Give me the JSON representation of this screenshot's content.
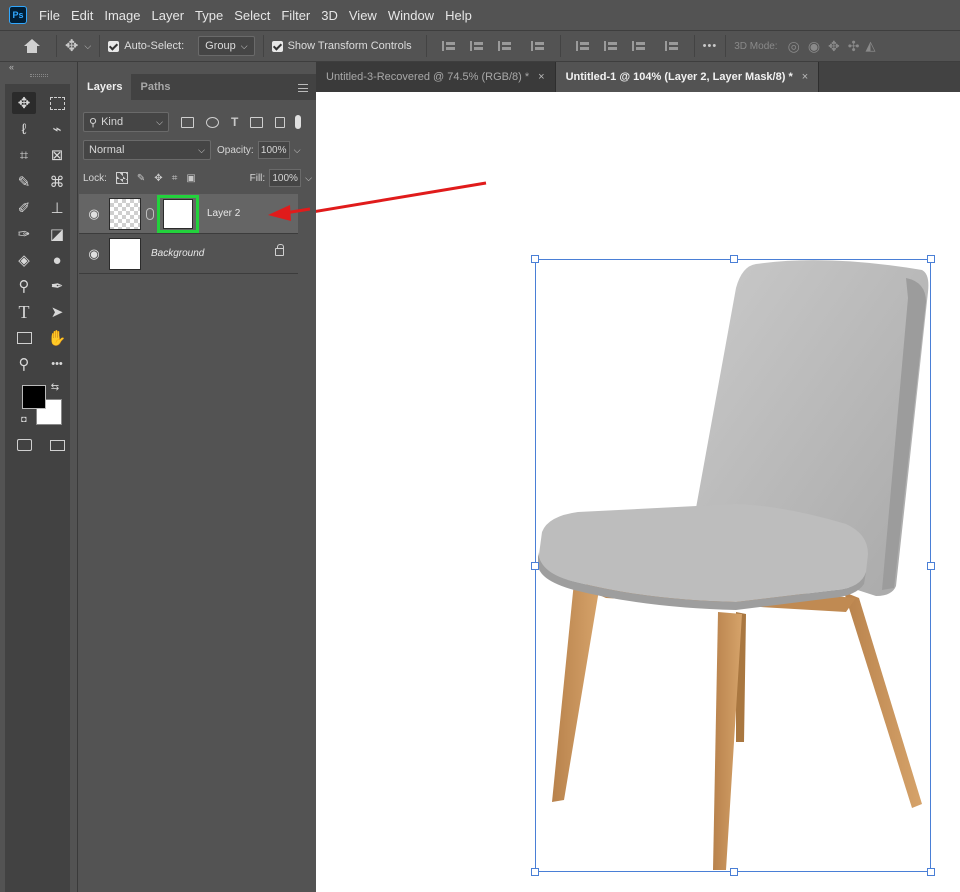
{
  "app": {
    "logo": "Ps",
    "menu": [
      "File",
      "Edit",
      "Image",
      "Layer",
      "Type",
      "Select",
      "Filter",
      "3D",
      "View",
      "Window",
      "Help"
    ]
  },
  "options": {
    "auto_select_label": "Auto-Select:",
    "auto_select_checked": true,
    "group_value": "Group",
    "show_transform_label": "Show Transform Controls",
    "show_transform_checked": true,
    "more": "•••",
    "mode_3d_label": "3D Mode:"
  },
  "layers_panel": {
    "tabs": [
      "Layers",
      "Paths"
    ],
    "kind_label": "Kind",
    "blend_mode": "Normal",
    "opacity_label": "Opacity:",
    "opacity_value": "100%",
    "lock_label": "Lock:",
    "fill_label": "Fill:",
    "fill_value": "100%",
    "layers": [
      {
        "name": "Layer 2",
        "selected": true,
        "has_mask": true
      },
      {
        "name": "Background",
        "selected": false,
        "locked": true
      }
    ]
  },
  "documents": {
    "tabs": [
      {
        "title": "Untitled-3-Recovered @ 74.5% (RGB/8) *",
        "active": false
      },
      {
        "title": "Untitled-1 @ 104% (Layer 2, Layer Mask/8) *",
        "active": true
      }
    ],
    "close_glyph": "×"
  },
  "colors": {
    "mask_highlight": "#22d23c",
    "annotation_arrow": "#e01b1b",
    "transform_box": "#4a7fd6",
    "foreground": "#000000",
    "background": "#ffffff"
  },
  "icons": {
    "tools": [
      "move-icon",
      "marquee-icon",
      "lasso-icon",
      "object-select-icon",
      "crop-icon",
      "frame-icon",
      "eyedropper-icon",
      "patch-icon",
      "brush-icon",
      "stamp-icon",
      "history-brush-icon",
      "eraser-icon",
      "bucket-icon",
      "blur-icon",
      "dodge-icon",
      "pen-icon",
      "type-icon",
      "path-select-icon",
      "rectangle-icon",
      "hand-icon",
      "zoom-icon",
      "more-icon"
    ]
  }
}
